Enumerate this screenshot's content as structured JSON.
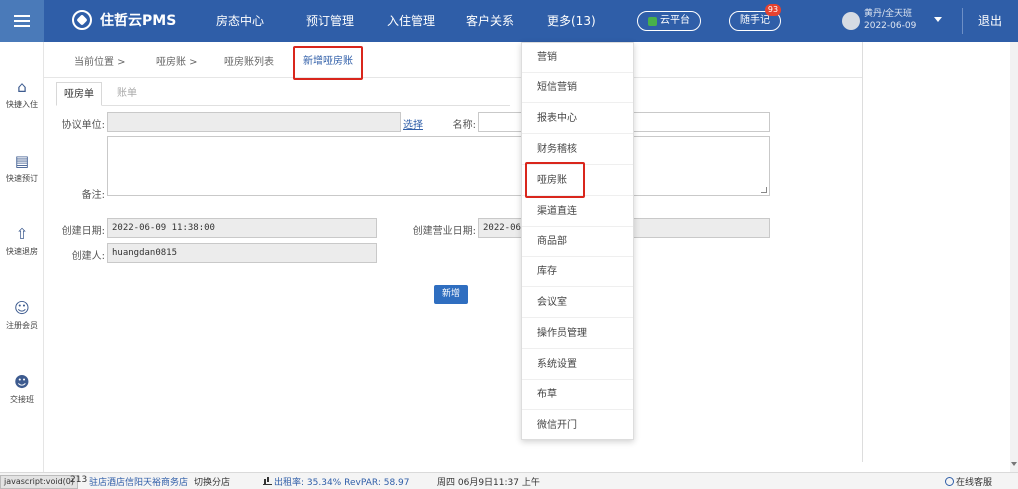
{
  "app": {
    "brand": "住哲云PMS",
    "nav": [
      "房态中心",
      "预订管理",
      "入住管理",
      "客户关系",
      "更多(13)"
    ],
    "cloud_platform": "云平台",
    "notes": "随手记",
    "notes_badge": "93",
    "user_name": "黄丹/全天班",
    "user_date": "2022-06-09",
    "logout": "退出"
  },
  "sidebar": {
    "items": [
      {
        "label": "快捷入住",
        "icon": "home-icon"
      },
      {
        "label": "快速预订",
        "icon": "document-icon"
      },
      {
        "label": "快速退房",
        "icon": "checkout-icon"
      },
      {
        "label": "注册会员",
        "icon": "add-user-icon"
      },
      {
        "label": "交接班",
        "icon": "shift-change-icon"
      }
    ]
  },
  "breadcrumb": {
    "current": "当前位置 >",
    "module": "哑房账 >",
    "list": "哑房账列表",
    "active": "新增哑房账"
  },
  "inner_tabs": [
    "哑房单",
    "账单"
  ],
  "form": {
    "agreement_label": "协议单位:",
    "agreement_value": "",
    "select_link": "选择",
    "name_label": "名称:",
    "name_value": "",
    "remark_label": "备注:",
    "create_date_label": "创建日期:",
    "create_date_value": "2022-06-09 11:38:00",
    "business_date_label": "创建营业日期:",
    "business_date_value": "2022-06-",
    "creator_label": "创建人:",
    "creator_value": "huangdan0815",
    "submit": "新增"
  },
  "more_menu": [
    "营销",
    "短信营销",
    "报表中心",
    "财务稽核",
    "哑房账",
    "渠道直连",
    "商品部",
    "库存",
    "会议室",
    "操作员管理",
    "系统设置",
    "布草",
    "微信开门"
  ],
  "statusbar": {
    "js": "javascript:void(0)",
    "hotel_prefix": "213",
    "hotel": "驻店酒店信阳天裕商务店",
    "switch": "切换分店",
    "occupancy_label": "出租率:",
    "occupancy": "35.34%",
    "revpar_label": "RevPAR:",
    "revpar": "58.97",
    "datetime": "周四 06月9日11:37 上午",
    "support": "在线客服"
  },
  "colors": {
    "topbar": "#2f5ea8",
    "highlight": "#d9261c",
    "button": "#2f6ec0"
  }
}
